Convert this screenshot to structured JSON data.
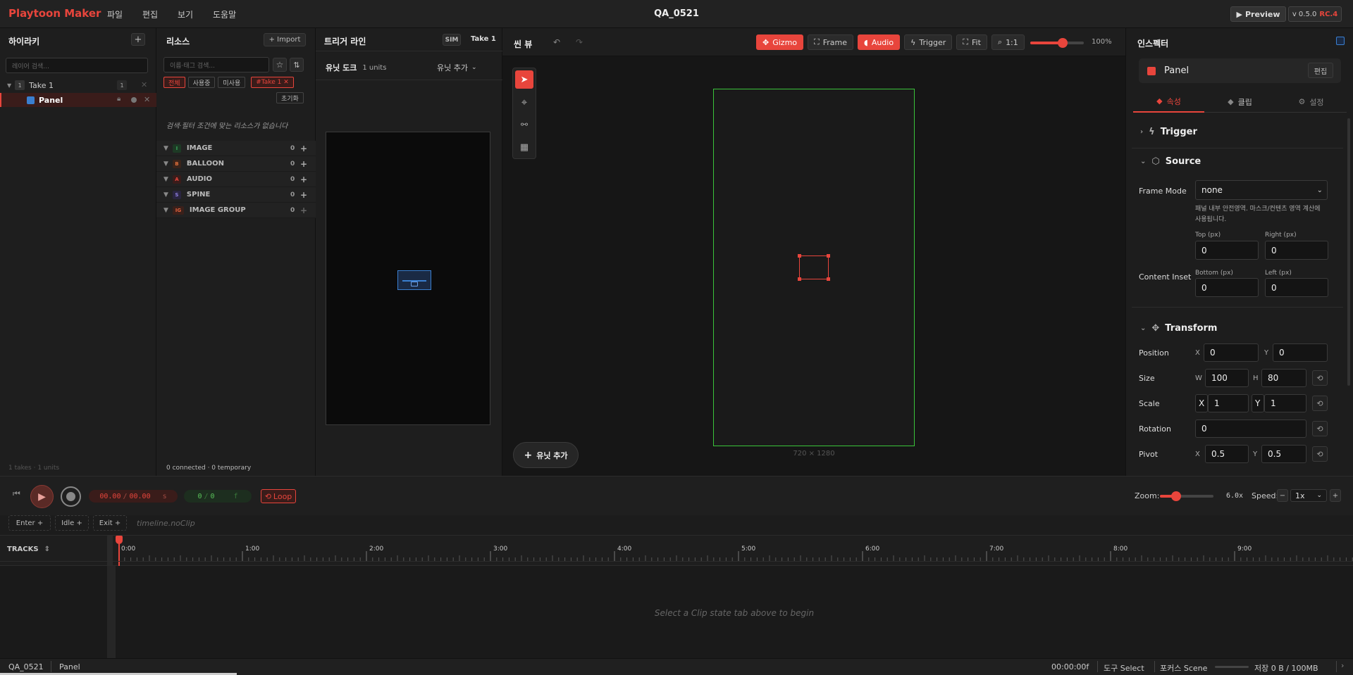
{
  "app": {
    "title": "Playtoon Maker",
    "menus": [
      "파일",
      "편집",
      "보기",
      "도움말"
    ],
    "document_title": "QA_0521",
    "preview_label": "Preview",
    "version": "v 0.5.0",
    "release": "RC.4"
  },
  "hierarchy": {
    "title": "하이라키",
    "add_label": "+",
    "search_placeholder": "레이어 검색...",
    "take_index": "1",
    "take_name": "Take 1",
    "take_count": "1",
    "panel_name": "Panel",
    "footer": "1 takes · 1 units"
  },
  "resources": {
    "title": "리소스",
    "import_label": "+ Import",
    "search_placeholder": "이름·태그 검색...",
    "filters": [
      "전체",
      "사용중",
      "미사용"
    ],
    "take_filter": "#Take 1 ✕",
    "reset_label": "초기화",
    "empty_message": "검색·필터 조건에 맞는 리소스가 없습니다",
    "categories": [
      {
        "letter": "I",
        "name": "IMAGE",
        "count": "0",
        "color": "#3aa35a"
      },
      {
        "letter": "B",
        "name": "BALLOON",
        "count": "0",
        "color": "#e0703c"
      },
      {
        "letter": "A",
        "name": "AUDIO",
        "count": "0",
        "color": "#e8453c"
      },
      {
        "letter": "S",
        "name": "SPINE",
        "count": "0",
        "color": "#8f7fe0"
      },
      {
        "letter": "IG",
        "name": "IMAGE GROUP",
        "count": "0",
        "color": "#e0603c"
      }
    ],
    "footer": "0 connected · 0 temporary"
  },
  "trigger": {
    "title": "트리거 라인",
    "sim_label": "SIM",
    "take_label": "Take 1",
    "dock_label": "유닛 도크",
    "dock_units": "1 units",
    "add_unit_label": "유닛 추가"
  },
  "scene": {
    "title": "씬 뷰",
    "gizmo": "Gizmo",
    "frame": "Frame",
    "audio": "Audio",
    "trigger": "Trigger",
    "fit": "Fit",
    "ratio": "1:1",
    "zoom_percent": "100%",
    "zoom_value": 60,
    "canvas_size": "720 × 1280",
    "add_unit_label": "유닛 추가"
  },
  "inspector": {
    "title": "인스펙터",
    "object_name": "Panel",
    "edit_label": "편집",
    "tabs": [
      "속성",
      "클립",
      "설정"
    ],
    "sections": {
      "trigger": "Trigger",
      "source": "Source",
      "transform": "Transform"
    },
    "frame_mode_label": "Frame Mode",
    "frame_mode_value": "none",
    "frame_mode_hint": "패널 내부 안전영역. 마스크/컨텐츠 영역 계산에 사용됩니다.",
    "content_inset_label": "Content Inset",
    "inset": {
      "top_label": "Top (px)",
      "top": "0",
      "right_label": "Right (px)",
      "right": "0",
      "bottom_label": "Bottom (px)",
      "bottom": "0",
      "left_label": "Left (px)",
      "left": "0"
    },
    "position_label": "Position",
    "pos_x": "0",
    "pos_y": "0",
    "size_label": "Size",
    "size_w": "100",
    "size_h": "80",
    "scale_label": "Scale",
    "scale_x": "1",
    "scale_y": "1",
    "rotation_label": "Rotation",
    "rotation": "0",
    "pivot_label": "Pivot",
    "pivot_x": "0.5",
    "pivot_y": "0.5",
    "axis_x": "X",
    "axis_y": "Y",
    "axis_w": "W",
    "axis_h": "H"
  },
  "transport": {
    "time": "00.00",
    "duration": "00.00",
    "time_unit": "s",
    "frame": "0",
    "frame_total": "0",
    "frame_unit": "f",
    "loop_label": "Loop",
    "zoom_label": "Zoom:",
    "zoom_value_text": "6.0x",
    "zoom_value": 30,
    "speed_label": "Speed:",
    "speed_value": "1x"
  },
  "clipbar": {
    "enter": "Enter +",
    "idle": "Idle +",
    "exit": "Exit +",
    "placeholder": "timeline.noClip"
  },
  "timeline": {
    "tracks_label": "TRACKS",
    "ticks": [
      "0:00",
      "1:00",
      "2:00",
      "3:00",
      "4:00",
      "5:00",
      "6:00",
      "7:00",
      "8:00",
      "9:00"
    ],
    "empty_message": "Select a Clip state tab above to begin"
  },
  "status": {
    "project": "QA_0521",
    "selection": "Panel",
    "timecode": "00:00:00f",
    "tool": "도구 Select",
    "focus": "포커스 Scene",
    "storage": "저장 0 B / 100MB"
  }
}
